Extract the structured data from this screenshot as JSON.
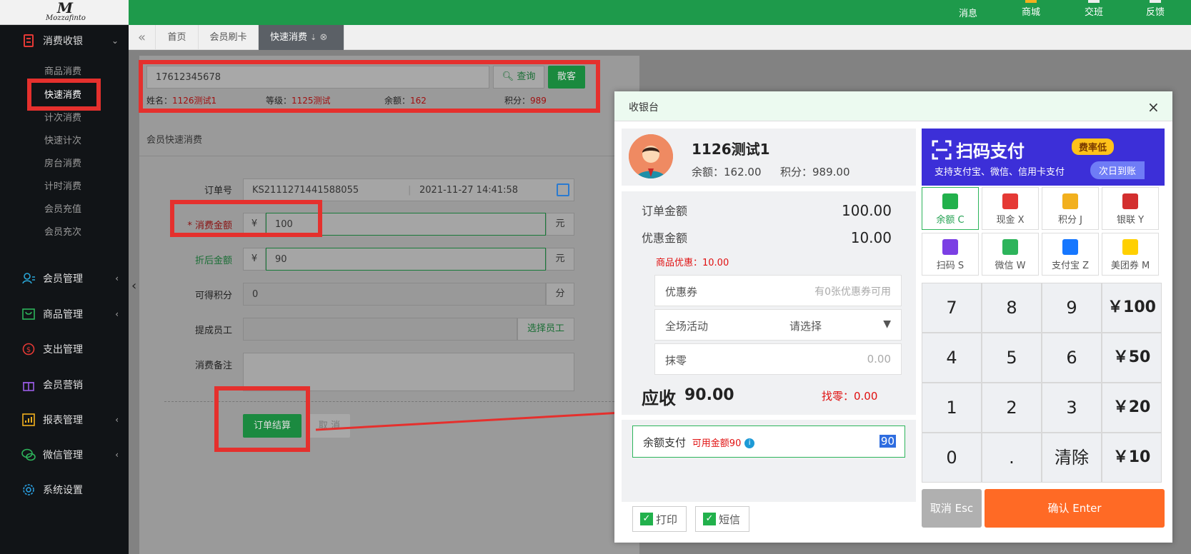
{
  "logo": {
    "mark": "M",
    "text": "Mozzafinto"
  },
  "sidebar": {
    "groups": [
      {
        "label": "消费收银",
        "icon": "cash-register-icon"
      },
      {
        "label": "会员管理",
        "icon": "member-icon"
      },
      {
        "label": "商品管理",
        "icon": "goods-icon"
      },
      {
        "label": "支出管理",
        "icon": "expense-icon"
      },
      {
        "label": "会员营销",
        "icon": "gift-icon"
      },
      {
        "label": "报表管理",
        "icon": "report-icon"
      },
      {
        "label": "微信管理",
        "icon": "wechat-icon"
      },
      {
        "label": "系统设置",
        "icon": "settings-icon"
      }
    ],
    "sub_items": [
      "商品消费",
      "快速消费",
      "计次消费",
      "快速计次",
      "房台消费",
      "计时消费",
      "会员充值",
      "会员充次"
    ]
  },
  "topbar": {
    "items": [
      "消息",
      "商城",
      "交班",
      "反馈"
    ]
  },
  "tabs": [
    "首页",
    "会员刷卡",
    "快速消费"
  ],
  "search": {
    "value": "17612345678",
    "query_label": "查询",
    "guest_label": "散客"
  },
  "member_info": {
    "name_label": "姓名：",
    "name": "1126测试1",
    "level_label": "等级：",
    "level": "1125测试",
    "balance_label": "余额：",
    "balance": "162",
    "points_label": "积分：",
    "points": "989"
  },
  "form": {
    "title": "会员快速消费",
    "order_no_label": "订单号",
    "order_no": "KS2111271441588055",
    "order_time": "2021-11-27 14:41:58",
    "amount_label": "* 消费金额",
    "currency": "¥",
    "amount": "100",
    "unit_yuan": "元",
    "discount_label": "折后金额",
    "discount_amount": "90",
    "points_label": "可得积分",
    "points_value": "0",
    "unit_points": "分",
    "staff_label": "提成员工",
    "staff_button": "选择员工",
    "remark_label": "消费备注",
    "checkout_label": "订单结算",
    "cancel_label": "取 消"
  },
  "modal": {
    "title": "收银台",
    "close": "×",
    "member_name": "1126测试1",
    "balance_text": "余额：162.00",
    "points_text": "积分：989.00",
    "order_amount_label": "订单金额",
    "order_amount": "100.00",
    "discount_label": "优惠金额",
    "discount_amount": "10.00",
    "goods_discount": "商品优惠：10.00",
    "coupon_label": "优惠券",
    "coupon_hint": "有0张优惠券可用",
    "activity_label": "全场活动",
    "activity_value": "请选择",
    "rounding_label": "抹零",
    "rounding_value": "0.00",
    "receivable_label": "应收",
    "receivable": "90.00",
    "change_text": "找零：0.00",
    "balance_pay_label": "余额支付",
    "available_text": "可用金额90",
    "balance_pay_value": "90",
    "print_label": "打印",
    "sms_label": "短信",
    "banner": {
      "title": "扫码支付",
      "badge": "费率低",
      "subtitle": "支持支付宝、微信、信用卡支付",
      "tag": "次日到账"
    },
    "pay_methods": [
      {
        "label": "余额  C",
        "icon": "balance-icon",
        "color": "#22b14c"
      },
      {
        "label": "现金  X",
        "icon": "cash-icon",
        "color": "#e53935"
      },
      {
        "label": "积分  J",
        "icon": "points-icon",
        "color": "#f2b01e"
      },
      {
        "label": "银联  Y",
        "icon": "unionpay-icon",
        "color": "#d32f2f"
      },
      {
        "label": "扫码  S",
        "icon": "scan-icon",
        "color": "#7b3fe4"
      },
      {
        "label": "微信  W",
        "icon": "wechat-pay-icon",
        "color": "#2db45b"
      },
      {
        "label": "支付宝  Z",
        "icon": "alipay-icon",
        "color": "#1677ff"
      },
      {
        "label": "美团券  M",
        "icon": "meituan-icon",
        "color": "#ffd000"
      }
    ],
    "keypad": [
      [
        "7",
        "8",
        "9",
        "￥100"
      ],
      [
        "4",
        "5",
        "6",
        "￥50"
      ],
      [
        "1",
        "2",
        "3",
        "￥20"
      ],
      [
        "0",
        ".",
        "清除",
        "￥10"
      ]
    ],
    "cancel_label": "取消 Esc",
    "confirm_label": "确认 Enter"
  }
}
